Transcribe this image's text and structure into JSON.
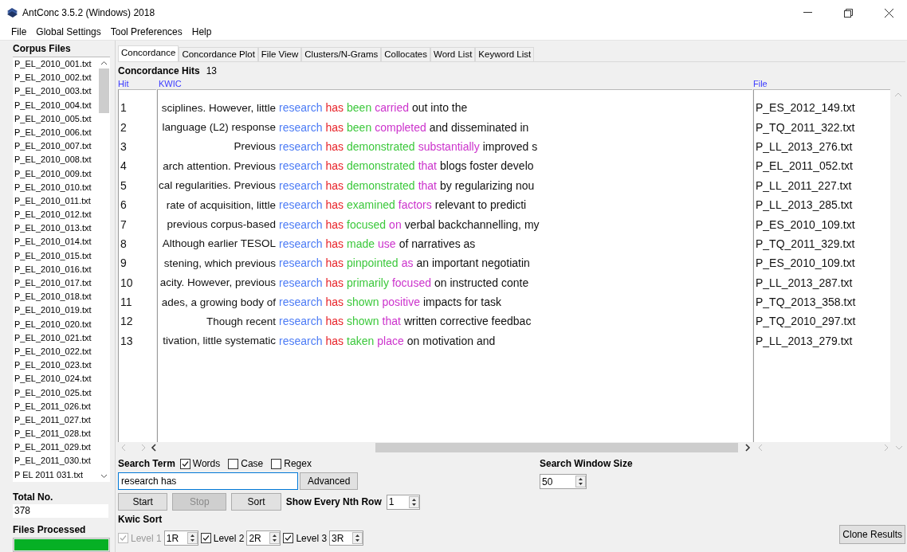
{
  "window": {
    "title": "AntConc 3.5.2 (Windows) 2018"
  },
  "menu": [
    "File",
    "Global Settings",
    "Tool Preferences",
    "Help"
  ],
  "corpus_files": {
    "title": "Corpus Files",
    "files": [
      "P_EL_2010_001.txt",
      "P_EL_2010_002.txt",
      "P_EL_2010_003.txt",
      "P_EL_2010_004.txt",
      "P_EL_2010_005.txt",
      "P_EL_2010_006.txt",
      "P_EL_2010_007.txt",
      "P_EL_2010_008.txt",
      "P_EL_2010_009.txt",
      "P_EL_2010_010.txt",
      "P_EL_2010_011.txt",
      "P_EL_2010_012.txt",
      "P_EL_2010_013.txt",
      "P_EL_2010_014.txt",
      "P_EL_2010_015.txt",
      "P_EL_2010_016.txt",
      "P_EL_2010_017.txt",
      "P_EL_2010_018.txt",
      "P_EL_2010_019.txt",
      "P_EL_2010_020.txt",
      "P_EL_2010_021.txt",
      "P_EL_2010_022.txt",
      "P_EL_2010_023.txt",
      "P_EL_2010_024.txt",
      "P_EL_2010_025.txt",
      "P_EL_2011_026.txt",
      "P_EL_2011_027.txt",
      "P_EL_2011_028.txt",
      "P_EL_2011_029.txt",
      "P_EL_2011_030.txt",
      "P EL 2011 031.txt"
    ]
  },
  "total_no": {
    "label": "Total No.",
    "value": "378"
  },
  "files_processed": {
    "label": "Files Processed",
    "level": 1
  },
  "tabs": [
    {
      "label": "Concordance",
      "selected": true
    },
    {
      "label": "Concordance Plot",
      "selected": false
    },
    {
      "label": "File View",
      "selected": false
    },
    {
      "label": "Clusters/N-Grams",
      "selected": false
    },
    {
      "label": "Collocates",
      "selected": false
    },
    {
      "label": "Word List",
      "selected": false
    },
    {
      "label": "Keyword List",
      "selected": false
    }
  ],
  "concordance": {
    "hits_label": "Concordance Hits",
    "hits_count": "13",
    "columns": {
      "hit": "Hit",
      "kwic": "KWIC",
      "file": "File"
    },
    "rows": [
      {
        "hit": "1",
        "left": "sciplines. However, little",
        "tokens": [
          {
            "text": "research",
            "color": "#4d7cf5"
          },
          {
            "text": "has",
            "color": "#e8252b"
          },
          {
            "text": "been",
            "color": "#3cc83c"
          },
          {
            "text": "carried",
            "color": "#cc33cc"
          }
        ],
        "right": "out into the",
        "file": "P_ES_2012_149.txt"
      },
      {
        "hit": "2",
        "left": "language (L2) response",
        "tokens": [
          {
            "text": "research",
            "color": "#4d7cf5"
          },
          {
            "text": "has",
            "color": "#e8252b"
          },
          {
            "text": "been",
            "color": "#3cc83c"
          },
          {
            "text": "completed",
            "color": "#cc33cc"
          }
        ],
        "right": "and disseminated in",
        "file": "P_TQ_2011_322.txt"
      },
      {
        "hit": "3",
        "left": "Previous",
        "tokens": [
          {
            "text": "research",
            "color": "#4d7cf5"
          },
          {
            "text": "has",
            "color": "#e8252b"
          },
          {
            "text": "demonstrated",
            "color": "#3cc83c"
          },
          {
            "text": "substantially",
            "color": "#cc33cc"
          }
        ],
        "right": "improved s",
        "file": "P_LL_2013_276.txt"
      },
      {
        "hit": "4",
        "left": "arch attention. Previous",
        "tokens": [
          {
            "text": "research",
            "color": "#4d7cf5"
          },
          {
            "text": "has",
            "color": "#e8252b"
          },
          {
            "text": "demonstrated",
            "color": "#3cc83c"
          },
          {
            "text": "that",
            "color": "#cc33cc"
          }
        ],
        "right": "blogs foster develo",
        "file": "P_EL_2011_052.txt"
      },
      {
        "hit": "5",
        "left": "cal regularities. Previous",
        "tokens": [
          {
            "text": "research",
            "color": "#4d7cf5"
          },
          {
            "text": "has",
            "color": "#e8252b"
          },
          {
            "text": "demonstrated",
            "color": "#3cc83c"
          },
          {
            "text": "that",
            "color": "#cc33cc"
          }
        ],
        "right": "by regularizing nou",
        "file": "P_LL_2011_227.txt"
      },
      {
        "hit": "6",
        "left": "rate of acquisition, little",
        "tokens": [
          {
            "text": "research",
            "color": "#4d7cf5"
          },
          {
            "text": "has",
            "color": "#e8252b"
          },
          {
            "text": "examined",
            "color": "#3cc83c"
          },
          {
            "text": "factors",
            "color": "#cc33cc"
          }
        ],
        "right": "relevant to predicti",
        "file": "P_LL_2013_285.txt"
      },
      {
        "hit": "7",
        "left": "previous corpus-based",
        "tokens": [
          {
            "text": "research",
            "color": "#4d7cf5"
          },
          {
            "text": "has",
            "color": "#e8252b"
          },
          {
            "text": "focused",
            "color": "#3cc83c"
          },
          {
            "text": "on",
            "color": "#cc33cc"
          }
        ],
        "right": "verbal backchannelling, my",
        "file": "P_ES_2010_109.txt"
      },
      {
        "hit": "8",
        "left": "Although earlier TESOL",
        "tokens": [
          {
            "text": "research",
            "color": "#4d7cf5"
          },
          {
            "text": "has",
            "color": "#e8252b"
          },
          {
            "text": "made",
            "color": "#3cc83c"
          },
          {
            "text": "use",
            "color": "#cc33cc"
          }
        ],
        "right": "of narratives as",
        "file": "P_TQ_2011_329.txt"
      },
      {
        "hit": "9",
        "left": "stening, which previous",
        "tokens": [
          {
            "text": "research",
            "color": "#4d7cf5"
          },
          {
            "text": "has",
            "color": "#e8252b"
          },
          {
            "text": "pinpointed",
            "color": "#3cc83c"
          },
          {
            "text": "as",
            "color": "#cc33cc"
          }
        ],
        "right": "an important negotiatin",
        "file": "P_ES_2010_109.txt"
      },
      {
        "hit": "10",
        "left": "acity. However, previous",
        "tokens": [
          {
            "text": "research",
            "color": "#4d7cf5"
          },
          {
            "text": "has",
            "color": "#e8252b"
          },
          {
            "text": "primarily",
            "color": "#3cc83c"
          },
          {
            "text": "focused",
            "color": "#cc33cc"
          }
        ],
        "right": "on instructed conte",
        "file": "P_LL_2013_287.txt"
      },
      {
        "hit": "11",
        "left": "ades, a growing body of",
        "tokens": [
          {
            "text": "research",
            "color": "#4d7cf5"
          },
          {
            "text": "has",
            "color": "#e8252b"
          },
          {
            "text": "shown",
            "color": "#3cc83c"
          },
          {
            "text": "positive",
            "color": "#cc33cc"
          }
        ],
        "right": "impacts for task",
        "file": "P_TQ_2013_358.txt"
      },
      {
        "hit": "12",
        "left": "Though recent",
        "tokens": [
          {
            "text": "research",
            "color": "#4d7cf5"
          },
          {
            "text": "has",
            "color": "#e8252b"
          },
          {
            "text": "shown",
            "color": "#3cc83c"
          },
          {
            "text": "that",
            "color": "#cc33cc"
          }
        ],
        "right": "written corrective feedbac",
        "file": "P_TQ_2010_297.txt"
      },
      {
        "hit": "13",
        "left": "tivation, little systematic",
        "tokens": [
          {
            "text": "research",
            "color": "#4d7cf5"
          },
          {
            "text": "has",
            "color": "#e8252b"
          },
          {
            "text": "taken",
            "color": "#3cc83c"
          },
          {
            "text": "place",
            "color": "#cc33cc"
          }
        ],
        "right": "on motivation and",
        "file": "P_LL_2013_279.txt"
      }
    ]
  },
  "search": {
    "term_label": "Search Term",
    "options": [
      {
        "label": "Words",
        "checked": true
      },
      {
        "label": "Case",
        "checked": false
      },
      {
        "label": "Regex",
        "checked": false
      }
    ],
    "value": "research has",
    "advanced_button": "Advanced",
    "window_size_label": "Search Window Size",
    "window_size": "50",
    "buttons": [
      {
        "label": "Start",
        "disabled": false
      },
      {
        "label": "Stop",
        "disabled": true
      },
      {
        "label": "Sort",
        "disabled": false
      }
    ],
    "nth_row_label": "Show Every Nth Row",
    "nth_row": "1"
  },
  "kwic_sort": {
    "label": "Kwic Sort",
    "levels": [
      {
        "label": "Level 1",
        "checked": true,
        "disabled": true,
        "value": "1R"
      },
      {
        "label": "Level 2",
        "checked": true,
        "disabled": false,
        "value": "2R"
      },
      {
        "label": "Level 3",
        "checked": true,
        "disabled": false,
        "value": "3R"
      }
    ]
  },
  "clone_button": "Clone Results"
}
